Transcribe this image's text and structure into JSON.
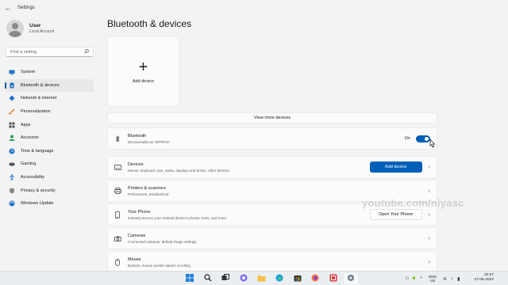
{
  "window": {
    "title": "Settings"
  },
  "user": {
    "name": "User",
    "account_type": "Local Account"
  },
  "search": {
    "placeholder": "Find a setting"
  },
  "sidebar": {
    "items": [
      {
        "label": "System",
        "icon": "system-icon",
        "active": false
      },
      {
        "label": "Bluetooth & devices",
        "icon": "bluetooth-icon",
        "active": true
      },
      {
        "label": "Network & internet",
        "icon": "network-icon",
        "active": false
      },
      {
        "label": "Personalization",
        "icon": "brush-icon",
        "active": false
      },
      {
        "label": "Apps",
        "icon": "apps-icon",
        "active": false
      },
      {
        "label": "Accounts",
        "icon": "accounts-icon",
        "active": false
      },
      {
        "label": "Time & language",
        "icon": "globe-clock-icon",
        "active": false
      },
      {
        "label": "Gaming",
        "icon": "gamepad-icon",
        "active": false
      },
      {
        "label": "Accessibility",
        "icon": "accessibility-icon",
        "active": false
      },
      {
        "label": "Privacy & security",
        "icon": "shield-icon",
        "active": false
      },
      {
        "label": "Windows Update",
        "icon": "update-icon",
        "active": false
      }
    ]
  },
  "main": {
    "title": "Bluetooth & devices",
    "add_device_tile": {
      "label": "Add device"
    },
    "view_more": "View more devices",
    "bluetooth": {
      "title": "Bluetooth",
      "subtitle": "Discoverable as “NITROS”",
      "state_label": "On",
      "enabled": true
    },
    "rows": [
      {
        "title": "Devices",
        "subtitle": "Mouse, keyboard, pen, audio, displays and docks, other devices",
        "button": "Add device"
      },
      {
        "title": "Printers & scanners",
        "subtitle": "Preferences, troubleshoot"
      },
      {
        "title": "Your Phone",
        "subtitle": "Instantly access your Android device's photos, texts, and more",
        "button": "Open Your Phone"
      },
      {
        "title": "Cameras",
        "subtitle": "Connected cameras, default image settings"
      },
      {
        "title": "Mouse",
        "subtitle": "Buttons, mouse pointer speed, scrolling"
      }
    ]
  },
  "watermark": "youtube.com/niyasc",
  "taskbar": {
    "language_line1": "ENG",
    "language_line2": "US",
    "time": "22:27",
    "date": "27-05-2022"
  },
  "colors": {
    "accent": "#005fb8",
    "background": "#f3f3f3",
    "card": "#fbfbfb"
  }
}
